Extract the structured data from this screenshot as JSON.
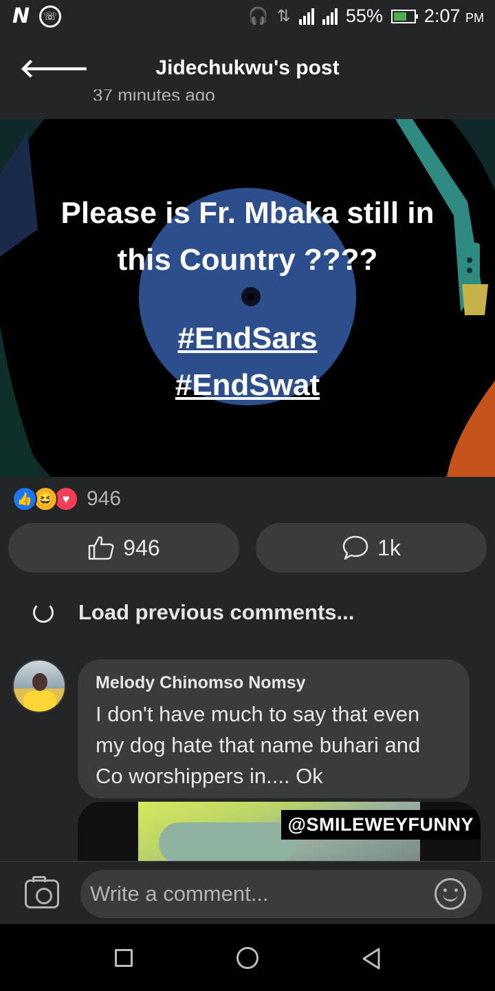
{
  "status_bar": {
    "carrier_icon": "N",
    "whatsapp_icon": "whatsapp-icon",
    "battery": "55%",
    "time": "2:07",
    "ampm": "PM"
  },
  "header": {
    "title": "Jidechukwu's post",
    "timestamp_partial": "37 minutes ago"
  },
  "post": {
    "line1": "Please is Fr. Mbaka still in",
    "line2": "this Country ????",
    "tag1": "#EndSars",
    "tag2": "#EndSwat"
  },
  "reactions": {
    "count": "946",
    "like_count": "946",
    "comment_count": "1k"
  },
  "comments": {
    "load_previous": "Load previous comments...",
    "items": [
      {
        "author": "Melody Chinomso Nomsy",
        "text": "I don't have much to say that even my dog hate that name buhari and Co worshippers in.... Ok",
        "media_label": "@SMILEWEYFUNNY"
      }
    ]
  },
  "composer": {
    "placeholder": "Write a comment..."
  },
  "colors": {
    "background": "#242526",
    "bubble": "#3a3b3c",
    "like_blue": "#1877f2",
    "love_red": "#f33e58",
    "haha_yellow": "#f7b125"
  }
}
